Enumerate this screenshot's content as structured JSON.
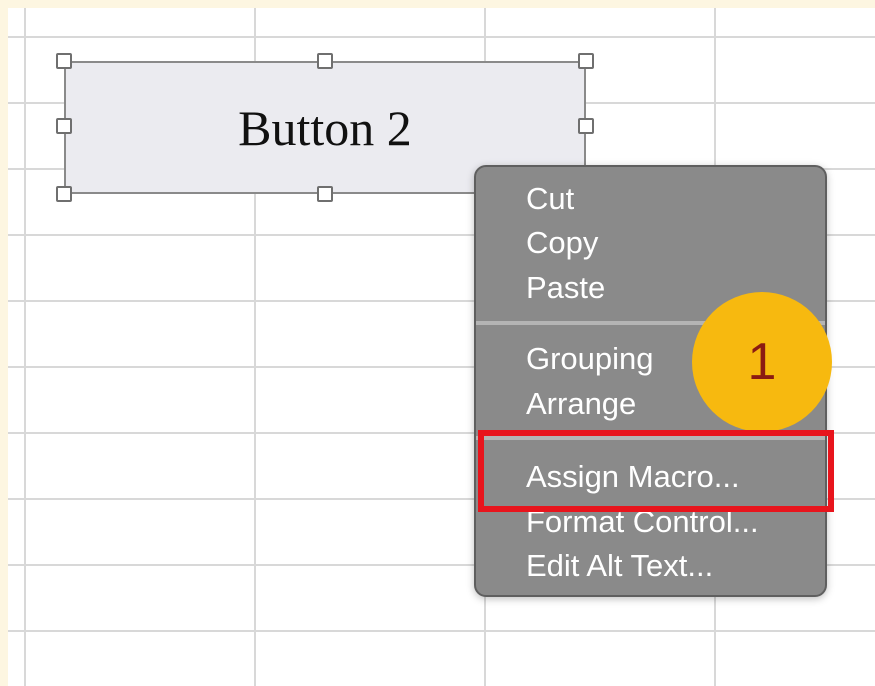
{
  "form_button": {
    "label": "Button 2"
  },
  "context_menu": {
    "groups": [
      {
        "items": [
          "Cut",
          "Copy",
          "Paste"
        ]
      },
      {
        "items": [
          "Grouping",
          "Arrange"
        ]
      },
      {
        "items": [
          "Assign Macro...",
          "Format Control...",
          "Edit Alt Text..."
        ]
      }
    ],
    "highlighted_item": "Assign Macro..."
  },
  "annotation": {
    "step_number": "1",
    "badge_color": "#f7b90f",
    "highlight_color": "#e8141c"
  },
  "colors": {
    "menu_background": "#8a8a8a",
    "menu_text": "#ffffff",
    "sheet_background": "#ffffff",
    "page_background": "#fdf6e1"
  }
}
